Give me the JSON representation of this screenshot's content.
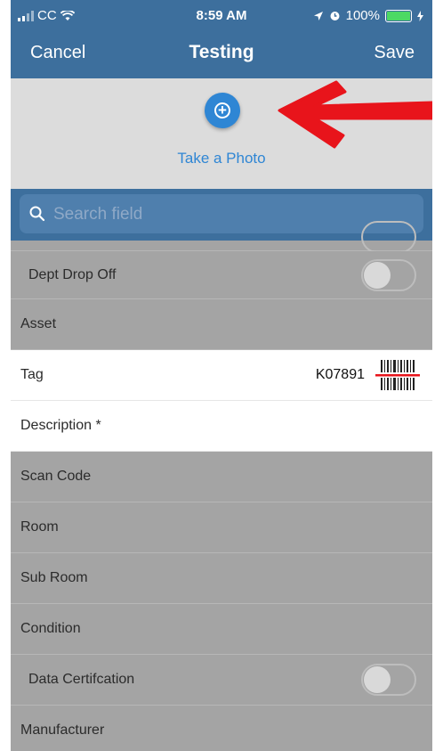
{
  "status_bar": {
    "carrier": "CC",
    "time": "8:59 AM",
    "battery": "100%",
    "icons": [
      "signal-icon",
      "wifi-icon",
      "location-icon",
      "alarm-icon",
      "battery-icon",
      "charging-icon"
    ]
  },
  "nav": {
    "cancel_label": "Cancel",
    "title": "Testing",
    "save_label": "Save"
  },
  "photo": {
    "take_photo_label": "Take a Photo",
    "icon": "camera-add-icon"
  },
  "search": {
    "placeholder": "Search field",
    "icon": "search-icon"
  },
  "fields": {
    "dept_drop_off": {
      "label": "Dept Drop Off",
      "on": false
    },
    "asset": {
      "label": "Asset"
    },
    "tag": {
      "label": "Tag",
      "value": "K07891"
    },
    "description": {
      "label": "Description *"
    },
    "scan_code": {
      "label": "Scan Code"
    },
    "room": {
      "label": "Room"
    },
    "sub_room": {
      "label": "Sub Room"
    },
    "condition": {
      "label": "Condition"
    },
    "data_certification": {
      "label": "Data Certifcation",
      "on": false
    },
    "manufacturer": {
      "label": "Manufacturer"
    }
  },
  "colors": {
    "nav_blue": "#3d6f9d",
    "accent_blue": "#2f86d4",
    "arrow_red": "#e8141b",
    "overlay_gray": "#a4a4a4"
  }
}
